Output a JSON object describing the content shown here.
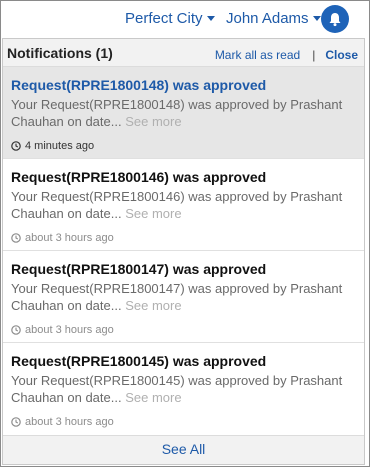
{
  "topbar": {
    "city": "Perfect City",
    "user": "John Adams",
    "bell_icon": "bell-icon"
  },
  "panel": {
    "title": "Notifications (1)",
    "mark_all_label": "Mark all as read",
    "separator": "|",
    "close_label": "Close",
    "see_all_label": "See All",
    "colors": {
      "link": "#1e5aa8",
      "bell_bg": "#1e63b8",
      "unread_bg": "#e6e6e6"
    }
  },
  "notifications": [
    {
      "title": "Request(RPRE1800148) was approved",
      "body": "Your Request(RPRE1800148) was approved by Prashant Chauhan on date",
      "ellipsis": "...",
      "see_more": "See more",
      "time": "4 minutes ago",
      "unread": true
    },
    {
      "title": "Request(RPRE1800146) was approved",
      "body": "Your Request(RPRE1800146) was approved by Prashant Chauhan on date",
      "ellipsis": "...",
      "see_more": "See more",
      "time": "about 3 hours ago",
      "unread": false
    },
    {
      "title": "Request(RPRE1800147) was approved",
      "body": "Your Request(RPRE1800147) was approved by Prashant Chauhan on date",
      "ellipsis": "...",
      "see_more": "See more",
      "time": "about 3 hours ago",
      "unread": false
    },
    {
      "title": "Request(RPRE1800145) was approved",
      "body": "Your Request(RPRE1800145) was approved by Prashant Chauhan on date",
      "ellipsis": "...",
      "see_more": "See more",
      "time": "about 3 hours ago",
      "unread": false
    }
  ]
}
